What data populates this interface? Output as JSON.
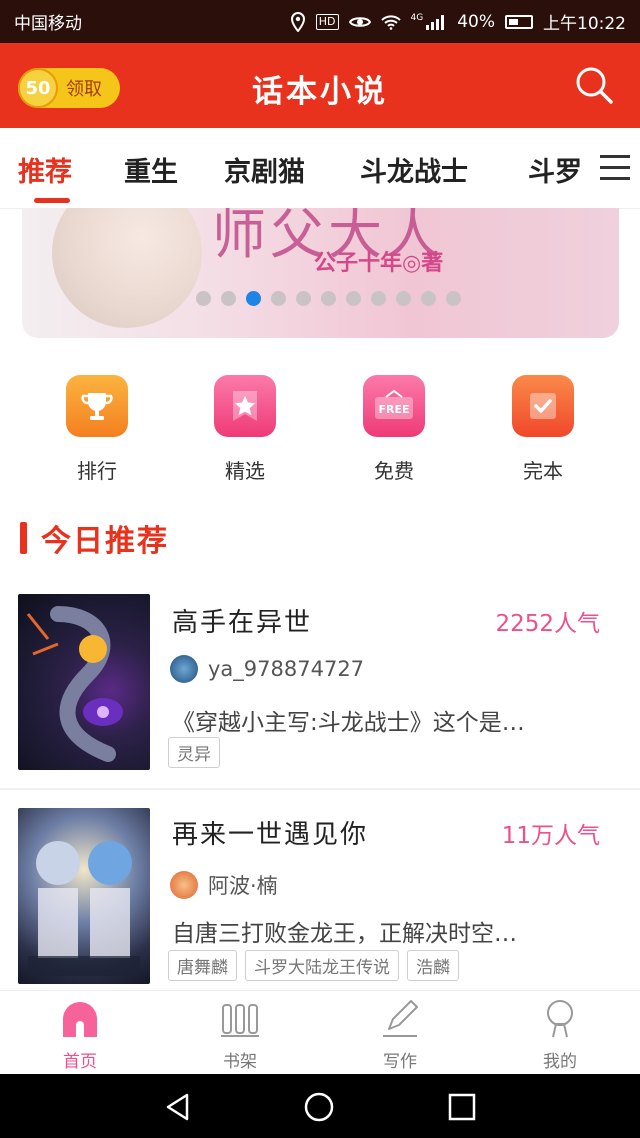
{
  "status_bar": {
    "carrier": "中国移动",
    "network": "4G",
    "battery": "40%",
    "time": "上午10:22"
  },
  "header": {
    "coins": "50",
    "claim_label": "领取",
    "title": "话本小说",
    "search_icon": "search-icon"
  },
  "tabs": [
    "推荐",
    "重生",
    "京剧猫",
    "斗龙战士",
    "斗罗"
  ],
  "banner": {
    "title": "师父大人",
    "author": "公子十年◎著",
    "dots": 11,
    "active_dot": 2
  },
  "categories": [
    {
      "label": "排行",
      "icon": "trophy-icon",
      "color": "#f7902a"
    },
    {
      "label": "精选",
      "icon": "star-icon",
      "color": "#f24e86"
    },
    {
      "label": "免费",
      "icon": "free-icon",
      "color": "#f24e86"
    },
    {
      "label": "完本",
      "icon": "check-icon",
      "color": "#f5622c"
    }
  ],
  "section_title": "今日推荐",
  "books": [
    {
      "title": "高手在异世",
      "popularity": "2252人气",
      "author": "ya_978874727",
      "description": "《穿越小主写:斗龙战士》这个是…",
      "tags": [
        "灵异"
      ]
    },
    {
      "title": "再来一世遇见你",
      "popularity": "11万人气",
      "author": "阿波·楠",
      "description": "自唐三打败金龙王，正解决时空…",
      "tags": [
        "唐舞麟",
        "斗罗大陆龙王传说",
        "浩麟"
      ]
    }
  ],
  "bottom_nav": [
    {
      "label": "首页",
      "icon": "home-icon",
      "active": true
    },
    {
      "label": "书架",
      "icon": "bookshelf-icon",
      "active": false
    },
    {
      "label": "写作",
      "icon": "pen-icon",
      "active": false
    },
    {
      "label": "我的",
      "icon": "profile-icon",
      "active": false
    }
  ],
  "colors": {
    "brand_red": "#e8321e",
    "pink": "#ee4f8d",
    "status_bar": "#2a0f0b"
  }
}
